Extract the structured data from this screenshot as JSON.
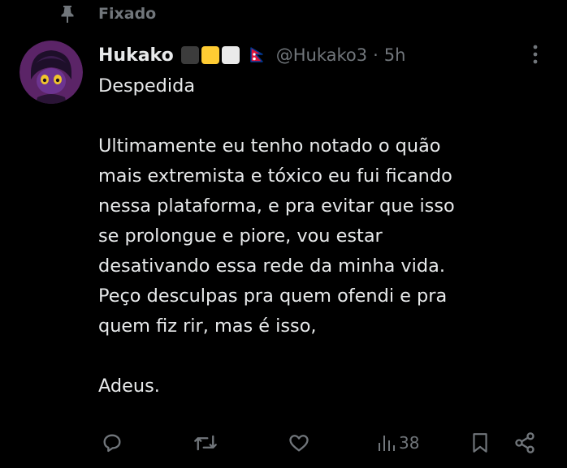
{
  "pinned": {
    "label": "Fixado",
    "icon": "pin-icon"
  },
  "author": {
    "display_name": "Hukako",
    "badges": [
      {
        "name": "black-square",
        "color": "#3c3c3c"
      },
      {
        "name": "yellow-square",
        "color": "#ffcc33"
      },
      {
        "name": "white-square",
        "color": "#eaeaea"
      }
    ],
    "flag": "nepal-flag",
    "handle": "@Hukako3",
    "separator": "·",
    "time": "5h"
  },
  "tweet": {
    "title": "Despedida",
    "paragraphs": [
      "Ultimamente eu tenho notado o quão\nmais extremista e tóxico eu fui ficando\nnessa plataforma, e pra evitar que isso\nse prolongue e piore, vou estar\ndesativando essa rede da minha vida.\nPeço desculpas pra quem ofendi e pra\nquem fiz rir, mas é isso,",
      "Adeus."
    ]
  },
  "actions": {
    "reply": {
      "icon": "reply-icon"
    },
    "retweet": {
      "icon": "retweet-icon"
    },
    "like": {
      "icon": "heart-icon"
    },
    "views": {
      "icon": "views-icon",
      "count": "38"
    },
    "bookmark": {
      "icon": "bookmark-icon"
    },
    "share": {
      "icon": "share-icon"
    }
  },
  "colors": {
    "background": "#000000",
    "text_primary": "#e7e9ea",
    "text_secondary": "#71767b",
    "avatar_bg": "#5b2467"
  }
}
